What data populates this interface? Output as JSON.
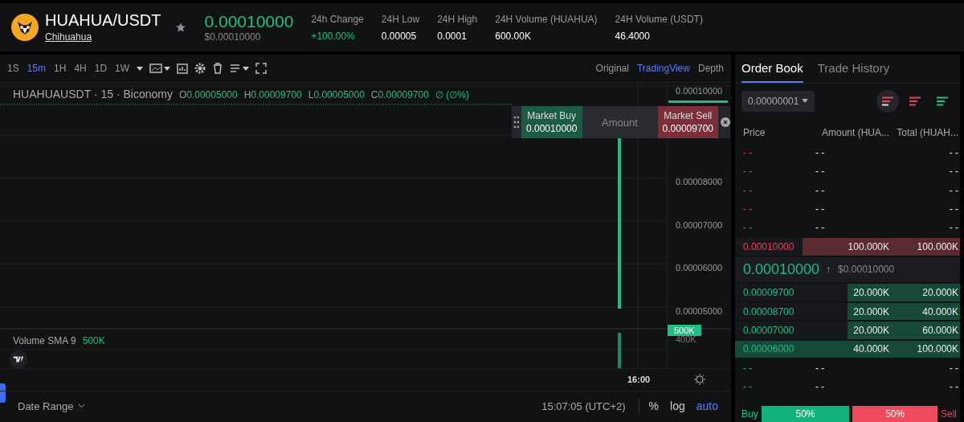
{
  "pair": {
    "symbol": "HUAHUA/USDT",
    "name": "Chihuahua",
    "favorite": false,
    "price": "0.00010000",
    "price_usd": "$0.00010000"
  },
  "stats": [
    {
      "label": "24h Change",
      "value": "+100.00%",
      "kind": "up"
    },
    {
      "label": "24H Low",
      "value": "0.00005",
      "kind": "plain"
    },
    {
      "label": "24H High",
      "value": "0.0001",
      "kind": "plain"
    },
    {
      "label": "24H Volume (HUAHUA)",
      "value": "600.00K",
      "kind": "plain"
    },
    {
      "label": "24H Volume (USDT)",
      "value": "46.4000",
      "kind": "plain"
    }
  ],
  "intervals": [
    {
      "label": "1S",
      "selected": false
    },
    {
      "label": "15m",
      "selected": true
    },
    {
      "label": "1H",
      "selected": false
    },
    {
      "label": "4H",
      "selected": false
    },
    {
      "label": "1D",
      "selected": false
    },
    {
      "label": "1W",
      "selected": false
    }
  ],
  "views": [
    {
      "label": "Original",
      "selected": false
    },
    {
      "label": "TradingView",
      "selected": true
    },
    {
      "label": "Depth",
      "selected": false
    }
  ],
  "chart": {
    "legend_title": "HUAHUAUSDT · 15 · Biconomy",
    "ohlc": [
      {
        "key": "O",
        "value": "0.00005000"
      },
      {
        "key": "H",
        "value": "0.00009700"
      },
      {
        "key": "L",
        "value": "0.00005000"
      },
      {
        "key": "C",
        "value": "0.00009700"
      }
    ],
    "change": "∅ (∅%)",
    "price_labels": [
      "0.00010000",
      "0.00008000",
      "0.00007000",
      "0.00006000",
      "0.00005000"
    ],
    "volume_legend": "Volume SMA 9",
    "volume_value": "500K",
    "volume_axis_label": "400K",
    "volume_tag": "500K",
    "time_label": "16:00",
    "trade_widget": {
      "buy_label": "Market Buy",
      "buy_price": "0.00010000",
      "amount_placeholder": "Amount",
      "sell_label": "Market Sell",
      "sell_price": "0.00009700"
    },
    "date_range": "Date Range",
    "clock": "15:07:05 (UTC+2)",
    "scale_buttons": [
      {
        "label": "%",
        "selected": false
      },
      {
        "label": "log",
        "selected": false
      },
      {
        "label": "auto",
        "selected": true
      }
    ]
  },
  "book_tabs": [
    {
      "label": "Order Book",
      "selected": true
    },
    {
      "label": "Trade History",
      "selected": false
    }
  ],
  "precision": "0.00000001",
  "book_views": [
    {
      "kind": "both",
      "selected": true
    },
    {
      "kind": "asks",
      "selected": false
    },
    {
      "kind": "bids",
      "selected": false
    }
  ],
  "book_columns": [
    "Price",
    "Amount (HUA...",
    "Total (HUAH..."
  ],
  "asks": [
    {
      "price": "- -",
      "amount": "- -",
      "total": "- -"
    },
    {
      "price": "- -",
      "amount": "- -",
      "total": "- -"
    },
    {
      "price": "- -",
      "amount": "- -",
      "total": "- -"
    },
    {
      "price": "- -",
      "amount": "- -",
      "total": "- -"
    },
    {
      "price": "- -",
      "amount": "- -",
      "total": "- -"
    },
    {
      "price": "0.00010000",
      "amount": "100.000K",
      "total": "100.000K",
      "level": 0.7
    }
  ],
  "last_price": {
    "price": "0.00010000",
    "arrow": "↑",
    "usd": "$0.00010000"
  },
  "bids": [
    {
      "price": "0.00009700",
      "amount": "20.000K",
      "total": "20.000K",
      "level": 0.5
    },
    {
      "price": "0.00008700",
      "amount": "20.000K",
      "total": "40.000K",
      "level": 0.5
    },
    {
      "price": "0.00007000",
      "amount": "20.000K",
      "total": "60.000K",
      "level": 0.5
    },
    {
      "price": "0.00006000",
      "amount": "40.000K",
      "total": "100.000K",
      "level": 1
    },
    {
      "price": "- -",
      "amount": "- -",
      "total": "- -"
    },
    {
      "price": "- -",
      "amount": "- -",
      "total": "- -"
    }
  ],
  "ratio": {
    "buy_label": "Buy",
    "buy_pct": "50%",
    "level": 0.5,
    "sell_pct": "50%",
    "sell_label": "Sell"
  }
}
